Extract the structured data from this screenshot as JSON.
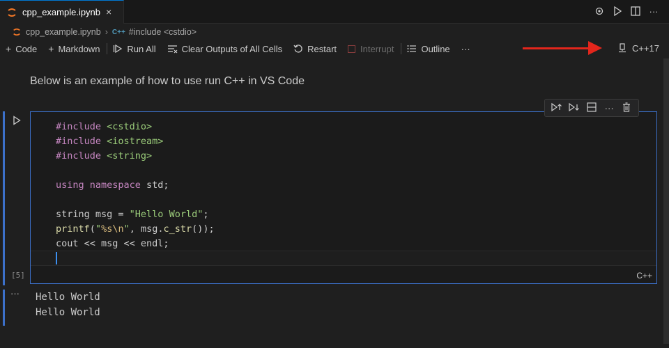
{
  "tab": {
    "title": "cpp_example.ipynb",
    "close_icon": "×",
    "actions": [
      "gear-icon",
      "run-icon",
      "split-editor-icon",
      "more-icon"
    ]
  },
  "breadcrumb": {
    "file": "cpp_example.ipynb",
    "lang_badge": "C++",
    "symbol": "#include <cstdio>"
  },
  "toolbar": {
    "code": "Code",
    "markdown": "Markdown",
    "run_all": "Run All",
    "clear_outputs": "Clear Outputs of All Cells",
    "restart": "Restart",
    "interrupt": "Interrupt",
    "outline": "Outline",
    "more": "···",
    "kernel": "C++17"
  },
  "markdown_cell": {
    "text": "Below is an example of how to use run C++ in VS Code"
  },
  "code_cell": {
    "exec_count": "[5]",
    "language": "C++",
    "lines": [
      "#include <cstdio>",
      "#include <iostream>",
      "#include <string>",
      "",
      "using namespace std;",
      "",
      "string msg = \"Hello World\";",
      "printf(\"%s\\n\", msg.c_str());",
      "cout << msg << endl;",
      ""
    ]
  },
  "output": {
    "lines": [
      "Hello World",
      "Hello World"
    ]
  },
  "colors": {
    "accent": "#3c70c9",
    "arrow": "#e3261c",
    "keyword": "#c586c0",
    "string": "#9bcc7a",
    "function": "#dcdcaa"
  }
}
